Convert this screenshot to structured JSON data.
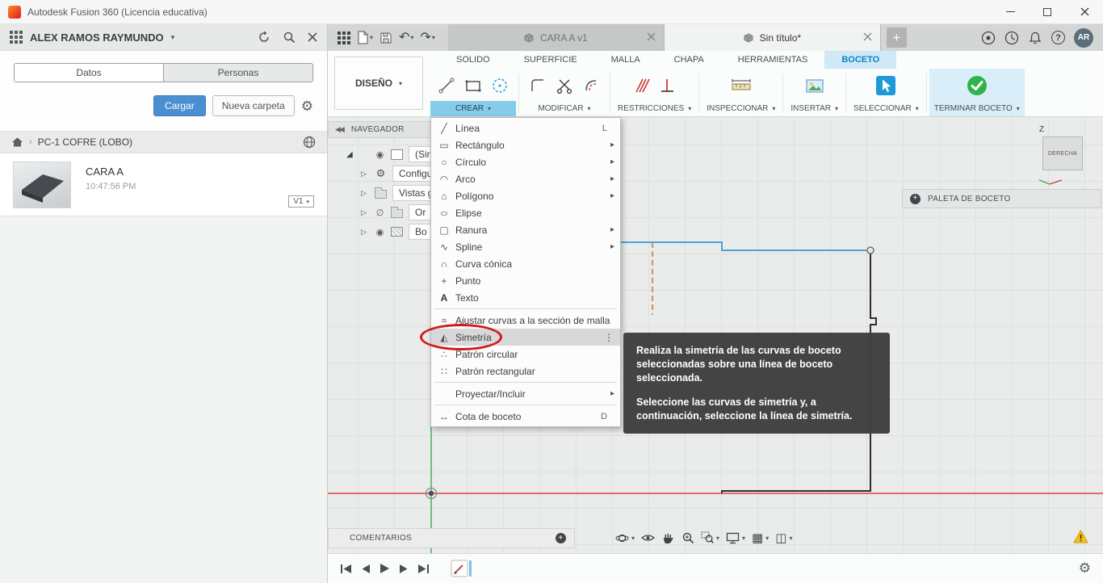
{
  "window": {
    "title": "Autodesk Fusion 360 (Licencia educativa)"
  },
  "header": {
    "avatar_initials": "AR"
  },
  "data_panel": {
    "user_name": "ALEX RAMOS RAYMUNDO",
    "tabs": [
      {
        "label": "Datos",
        "flags": "active"
      },
      {
        "label": "Personas"
      }
    ],
    "upload_button": "Cargar",
    "new_folder_button": "Nueva carpeta",
    "breadcrumb": "PC-1 COFRE (LOBO)",
    "item": {
      "name": "CARA A",
      "time": "10:47:56 PM",
      "version": "V1"
    }
  },
  "doc_tabs": [
    {
      "label": "CARA A v1"
    },
    {
      "label": "Sin título*",
      "flags": "active"
    }
  ],
  "ribbon": {
    "design_label": "DISEÑO",
    "tabs": [
      {
        "label": "SOLIDO"
      },
      {
        "label": "SUPERFICIE"
      },
      {
        "label": "MALLA"
      },
      {
        "label": "CHAPA"
      },
      {
        "label": "HERRAMIENTAS"
      },
      {
        "label": "BOCETO",
        "flags": "active"
      }
    ],
    "groups": [
      {
        "label": "CREAR"
      },
      {
        "label": "MODIFICAR"
      },
      {
        "label": "RESTRICCIONES"
      },
      {
        "label": "INSPECCIONAR"
      },
      {
        "label": "INSERTAR"
      },
      {
        "label": "SELECCIONAR"
      },
      {
        "label": "TERMINAR BOCETO"
      }
    ]
  },
  "crear_menu": {
    "items": [
      {
        "label": "Línea",
        "shortcut": "L",
        "icon": "line"
      },
      {
        "label": "Rectángulo",
        "icon": "rectangle",
        "flags": "submenu"
      },
      {
        "label": "Círculo",
        "icon": "circle",
        "flags": "submenu"
      },
      {
        "label": "Arco",
        "icon": "arc",
        "flags": "submenu"
      },
      {
        "label": "Polígono",
        "icon": "polygon",
        "flags": "submenu"
      },
      {
        "label": "Elipse",
        "icon": "ellipse"
      },
      {
        "label": "Ranura",
        "icon": "slot",
        "flags": "submenu"
      },
      {
        "label": "Spline",
        "icon": "spline",
        "flags": "submenu"
      },
      {
        "label": "Curva cónica",
        "icon": "conic"
      },
      {
        "label": "Punto",
        "icon": "point"
      },
      {
        "label": "Texto",
        "icon": "text",
        "flags": "separator-after"
      },
      {
        "label": "Ajustar curvas a la sección de malla",
        "icon": "meshfit"
      },
      {
        "label": "Simetría",
        "icon": "mirror",
        "flags": "highlighted more"
      },
      {
        "label": "Patrón circular",
        "icon": "circpattern"
      },
      {
        "label": "Patrón rectangular",
        "icon": "rectpattern",
        "flags": "separator-after"
      },
      {
        "label": "Proyectar/Incluir",
        "flags": "submenu separator-after"
      },
      {
        "label": "Cota de boceto",
        "shortcut": "D",
        "icon": "dimension"
      }
    ]
  },
  "tooltip": {
    "paragraph1": "Realiza la simetría de las curvas de boceto seleccionadas sobre una línea de boceto seleccionada.",
    "paragraph2": "Seleccione las curvas de simetría y, a continuación, seleccione la línea de simetría."
  },
  "navegador": {
    "title": "NAVEGADOR",
    "items": [
      {
        "label": "(Sin g",
        "icon": "doc",
        "flags": "marker eye-on"
      },
      {
        "label": "Configu",
        "icon": "gear",
        "flags": "caret"
      },
      {
        "label": "Vistas g",
        "icon": "folder",
        "flags": "caret"
      },
      {
        "label": "Or",
        "icon": "folder",
        "flags": "caret eye-off"
      },
      {
        "label": "Bo",
        "icon": "sketch",
        "flags": "caret eye-on"
      }
    ]
  },
  "viewcube": {
    "face": "DERECHA",
    "axis": "Z"
  },
  "panels": {
    "paleta_title": "PALETA DE BOCETO",
    "comentarios_title": "COMENTARIOS"
  }
}
